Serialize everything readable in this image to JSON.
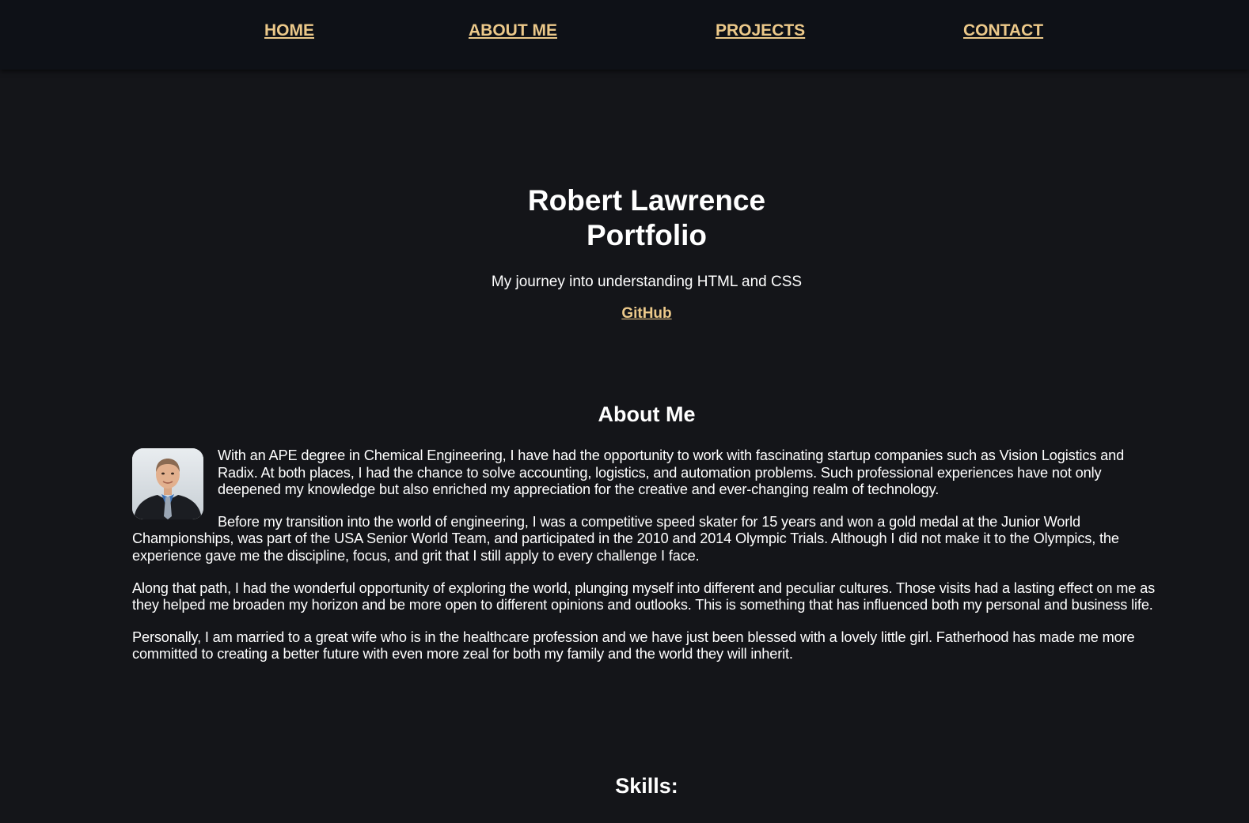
{
  "nav": {
    "items": [
      {
        "label": "HOME"
      },
      {
        "label": "ABOUT ME"
      },
      {
        "label": "PROJECTS"
      },
      {
        "label": "CONTACT"
      }
    ]
  },
  "hero": {
    "title_line1": "Robert Lawrence",
    "title_line2": "Portfolio",
    "tagline": "My journey into understanding HTML and CSS",
    "github_label": "GitHub"
  },
  "about": {
    "heading": "About Me",
    "paragraphs": [
      "With an APE degree in Chemical Engineering, I have had the opportunity to work with fascinating startup companies such as Vision Logistics and Radix. At both places, I had the chance to solve accounting, logistics, and automation problems. Such professional experiences have not only deepened my knowledge but also enriched my appreciation for the creative and ever-changing realm of technology.",
      "Before my transition into the world of engineering, I was a competitive speed skater for 15 years and won a gold medal at the Junior World Championships, was part of the USA Senior World Team, and participated in the 2010 and 2014 Olympic Trials. Although I did not make it to the Olympics, the experience gave me the discipline, focus, and grit that I still apply to every challenge I face.",
      "Along that path, I had the wonderful opportunity of exploring the world, plunging myself into different and peculiar cultures. Those visits had a lasting effect on me as they helped me broaden my horizon and be more open to different opinions and outlooks. This is something that has influenced both my personal and business life.",
      "Personally, I am married to a great wife who is in the healthcare profession and we have just been blessed with a lovely little girl. Fatherhood has made me more committed to creating a better future with even more zeal for both my family and the world they will inherit."
    ]
  },
  "skills": {
    "heading": "Skills:"
  },
  "colors": {
    "background": "#141519",
    "nav_background": "#0e1117",
    "accent": "#ecc98a",
    "text": "#ffffff"
  }
}
